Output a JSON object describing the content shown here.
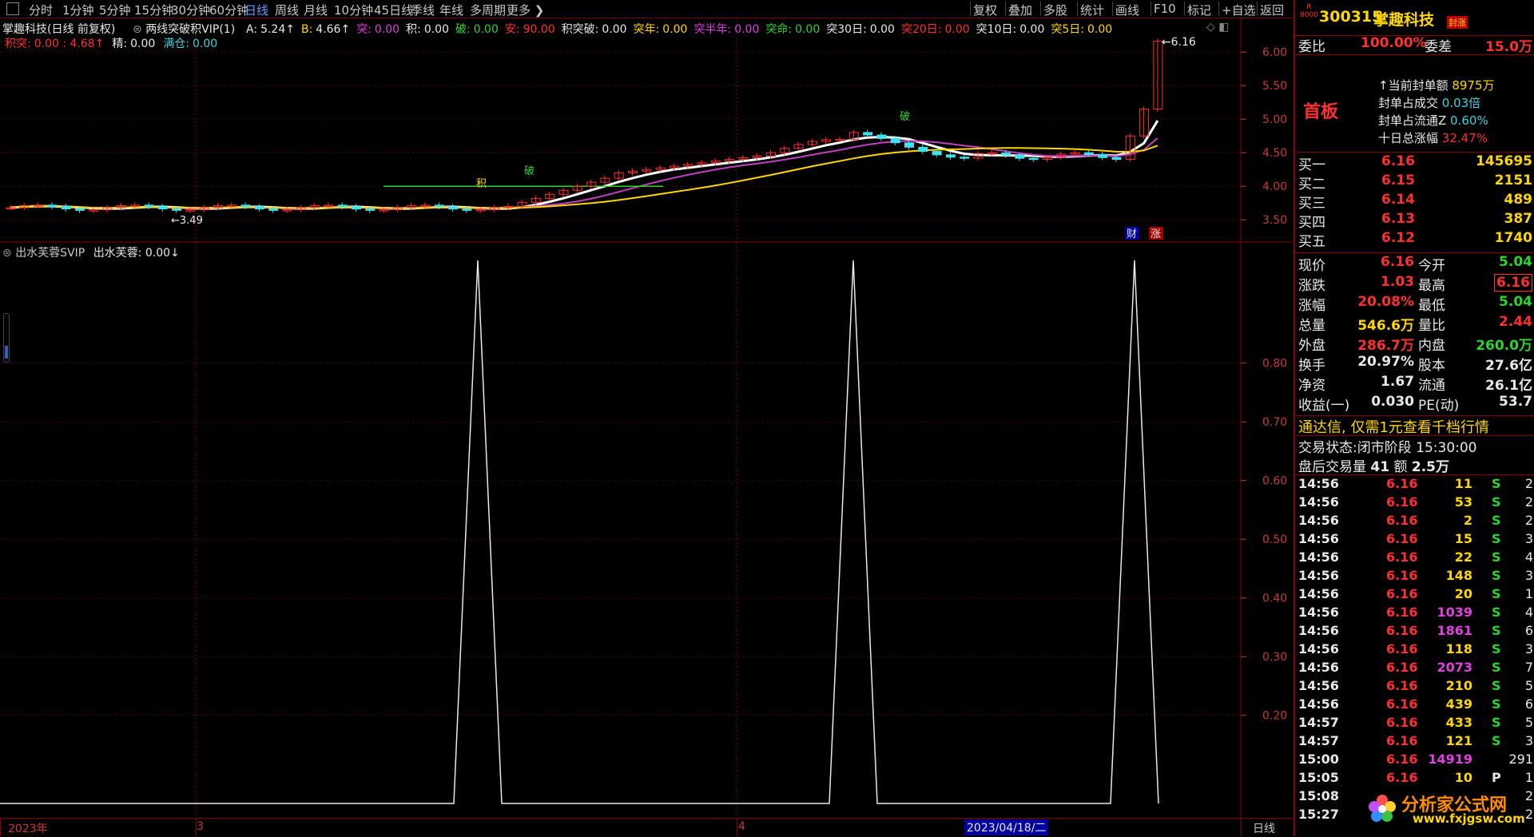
{
  "toolbar": {
    "periods": [
      "分时",
      "1分钟",
      "5分钟",
      "15分钟",
      "30分钟",
      "60分钟",
      "日线",
      "周线",
      "月线",
      "10分钟",
      "45日线",
      "季线",
      "年线",
      "多周期",
      "更多"
    ],
    "active_period": "日线",
    "right_buttons": [
      "复权",
      "叠加",
      "多股",
      "统计",
      "画线",
      "F10",
      "标记",
      "+自选",
      "返回"
    ]
  },
  "upper_info": {
    "stock_title": "掌趣科技(日线 前复权)",
    "indicator_name": "两线突破积VIP(1)",
    "row1": [
      {
        "k": "A:",
        "v": "5.24",
        "c": "white"
      },
      {
        "k": "B:",
        "v": "4.66",
        "c": "yellow"
      },
      {
        "k": "突:",
        "v": "0.00",
        "c": "magenta"
      },
      {
        "k": "积:",
        "v": "0.00",
        "c": "white"
      },
      {
        "k": "破:",
        "v": "0.00",
        "c": "green"
      },
      {
        "k": "安:",
        "v": "90.00",
        "c": "red"
      },
      {
        "k": "积突破:",
        "v": "0.00",
        "c": "white"
      },
      {
        "k": "突年:",
        "v": "0.00",
        "c": "yellow"
      },
      {
        "k": "突半年:",
        "v": "0.00",
        "c": "magenta"
      },
      {
        "k": "突命:",
        "v": "0.00",
        "c": "green"
      },
      {
        "k": "突30日:",
        "v": "0.00",
        "c": "white"
      },
      {
        "k": "突20日:",
        "v": "0.00",
        "c": "red"
      },
      {
        "k": "突10日:",
        "v": "0.00",
        "c": "white"
      },
      {
        "k": "突5日:",
        "v": "0.00",
        "c": "yellow"
      }
    ],
    "row2": [
      {
        "k": "积突:",
        "v": "0.00 : 4.68",
        "c": "red"
      },
      {
        "k": "精:",
        "v": "0.00",
        "c": "white"
      },
      {
        "k": "满仓:",
        "v": "0.00",
        "c": "cyan"
      }
    ],
    "price_axis": [
      "6.00",
      "5.50",
      "5.00",
      "4.50",
      "4.00",
      "3.50"
    ],
    "high_label": "6.16",
    "low_label": "3.49",
    "marks": {
      "ji": "积",
      "po": "破",
      "cai": "财",
      "zhang": "涨"
    }
  },
  "lower_info": {
    "indicator_name": "出水芙蓉SVIP",
    "value_label": "出水芙蓉:",
    "value": "0.00",
    "axis": [
      "0.80",
      "0.70",
      "0.60",
      "0.50",
      "0.40",
      "0.30",
      "0.20"
    ]
  },
  "date_bar": {
    "labels": [
      "2023年",
      "3",
      "4"
    ],
    "highlight_date": "2023/04/18/二",
    "period": "日线"
  },
  "quote": {
    "code": "300315",
    "name": "掌趣科技",
    "badge": "封涨",
    "r_label": "R",
    "r_sub": "8000",
    "weibi_label": "委比",
    "weibi": "100.00%",
    "weicha_label": "委差",
    "weicha": "15.0万",
    "tag": "首板",
    "seal": [
      {
        "k": "当前封单额",
        "v": "8975万",
        "c": "yellow"
      },
      {
        "k": "封单占成交",
        "v": "0.03倍",
        "c": "cyan"
      },
      {
        "k": "封单占流通Z",
        "v": "0.60%",
        "c": "cyan"
      },
      {
        "k": "十日总涨幅",
        "v": "32.47%",
        "c": "red"
      }
    ],
    "bids": [
      {
        "label": "买一",
        "price": "6.16",
        "vol": "145695"
      },
      {
        "label": "买二",
        "price": "6.15",
        "vol": "2151"
      },
      {
        "label": "买三",
        "price": "6.14",
        "vol": "489"
      },
      {
        "label": "买四",
        "price": "6.13",
        "vol": "387"
      },
      {
        "label": "买五",
        "price": "6.12",
        "vol": "1740"
      }
    ],
    "stats": [
      {
        "l1": "现价",
        "v1": "6.16",
        "c1": "red",
        "l2": "今开",
        "v2": "5.04",
        "c2": "green"
      },
      {
        "l1": "涨跌",
        "v1": "1.03",
        "c1": "red",
        "l2": "最高",
        "v2": "6.16",
        "c2": "red"
      },
      {
        "l1": "涨幅",
        "v1": "20.08%",
        "c1": "red",
        "l2": "最低",
        "v2": "5.04",
        "c2": "green"
      },
      {
        "l1": "总量",
        "v1": "546.6万",
        "c1": "yellow",
        "l2": "量比",
        "v2": "2.44",
        "c2": "red"
      },
      {
        "l1": "外盘",
        "v1": "286.7万",
        "c1": "red",
        "l2": "内盘",
        "v2": "260.0万",
        "c2": "green"
      },
      {
        "l1": "换手",
        "v1": "20.97%",
        "c1": "white",
        "l2": "股本",
        "v2": "27.6亿",
        "c2": "white"
      },
      {
        "l1": "净资",
        "v1": "1.67",
        "c1": "white",
        "l2": "流通",
        "v2": "26.1亿",
        "c2": "white"
      },
      {
        "l1": "收益(一)",
        "v1": "0.030",
        "c1": "white",
        "l2": "PE(动)",
        "v2": "53.7",
        "c2": "white"
      }
    ],
    "promo": "通达信, 仅需1元查看千档行情",
    "status_label": "交易状态:",
    "status": "闭市阶段 15:30:00",
    "after_label": "盘后交易量",
    "after_vol": "41",
    "after_amt_label": "额",
    "after_amt": "2.5万"
  },
  "ticks": [
    {
      "t": "14:56",
      "p": "6.16",
      "v": "11",
      "vc": "yellow",
      "s": "S",
      "n": "2"
    },
    {
      "t": "14:56",
      "p": "6.16",
      "v": "53",
      "vc": "yellow",
      "s": "S",
      "n": "2"
    },
    {
      "t": "14:56",
      "p": "6.16",
      "v": "2",
      "vc": "yellow",
      "s": "S",
      "n": "2"
    },
    {
      "t": "14:56",
      "p": "6.16",
      "v": "15",
      "vc": "yellow",
      "s": "S",
      "n": "3"
    },
    {
      "t": "14:56",
      "p": "6.16",
      "v": "22",
      "vc": "yellow",
      "s": "S",
      "n": "4"
    },
    {
      "t": "14:56",
      "p": "6.16",
      "v": "148",
      "vc": "yellow",
      "s": "S",
      "n": "3"
    },
    {
      "t": "14:56",
      "p": "6.16",
      "v": "20",
      "vc": "yellow",
      "s": "S",
      "n": "1"
    },
    {
      "t": "14:56",
      "p": "6.16",
      "v": "1039",
      "vc": "magenta",
      "s": "S",
      "n": "4"
    },
    {
      "t": "14:56",
      "p": "6.16",
      "v": "1861",
      "vc": "magenta",
      "s": "S",
      "n": "6"
    },
    {
      "t": "14:56",
      "p": "6.16",
      "v": "118",
      "vc": "yellow",
      "s": "S",
      "n": "3"
    },
    {
      "t": "14:56",
      "p": "6.16",
      "v": "2073",
      "vc": "magenta",
      "s": "S",
      "n": "7"
    },
    {
      "t": "14:56",
      "p": "6.16",
      "v": "210",
      "vc": "yellow",
      "s": "S",
      "n": "5"
    },
    {
      "t": "14:56",
      "p": "6.16",
      "v": "439",
      "vc": "yellow",
      "s": "S",
      "n": "6"
    },
    {
      "t": "14:57",
      "p": "6.16",
      "v": "433",
      "vc": "yellow",
      "s": "S",
      "n": "5"
    },
    {
      "t": "14:57",
      "p": "6.16",
      "v": "121",
      "vc": "yellow",
      "s": "S",
      "n": "3"
    },
    {
      "t": "15:00",
      "p": "6.16",
      "v": "14919",
      "vc": "magenta",
      "s": "",
      "n": "291"
    },
    {
      "t": "15:05",
      "p": "6.16",
      "v": "10",
      "vc": "yellow",
      "s": "P",
      "n": "1"
    },
    {
      "t": "15:08",
      "p": "",
      "v": "",
      "vc": "yellow",
      "s": "",
      "n": "2"
    },
    {
      "t": "15:27",
      "p": "",
      "v": "",
      "vc": "yellow",
      "s": "",
      "n": "2"
    }
  ],
  "watermark": {
    "cn": "分析家公式网",
    "url": "www.fxjgsw.com"
  },
  "colors": {
    "up": "#ff3030",
    "down": "#2fd32f",
    "ma_white": "#ffffff",
    "ma_yellow": "#ffd700",
    "ma_magenta": "#c040c0",
    "grid": "#8b0000",
    "candle_down": "#40e0f0"
  }
}
